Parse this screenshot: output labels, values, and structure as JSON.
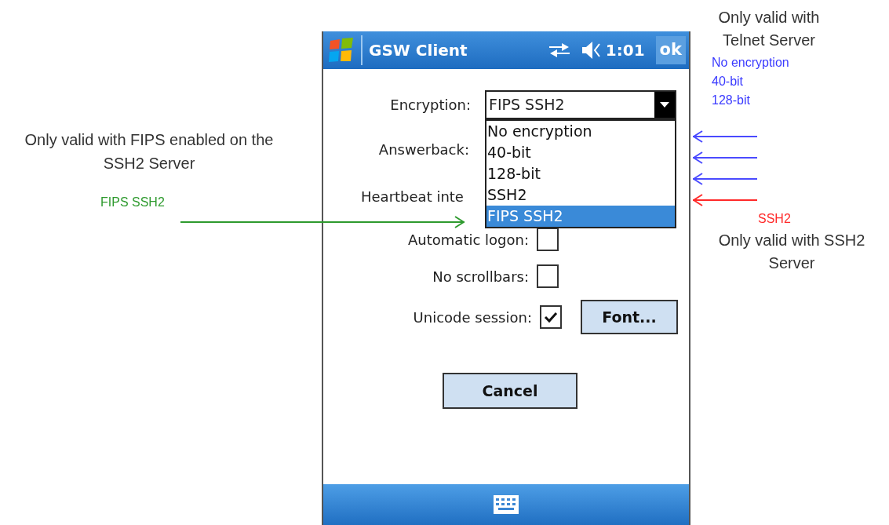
{
  "window": {
    "title": "GSW Client",
    "time": "1:01",
    "ok_label": "ok"
  },
  "form": {
    "encryption": {
      "label": "Encryption:",
      "value": "FIPS SSH2",
      "expanded": true,
      "options": [
        {
          "label": "No encryption",
          "selected": false
        },
        {
          "label": "40-bit",
          "selected": false
        },
        {
          "label": "128-bit",
          "selected": false
        },
        {
          "label": "SSH2",
          "selected": false
        },
        {
          "label": "FIPS SSH2",
          "selected": true
        }
      ]
    },
    "answerback": {
      "label": "Answerback:"
    },
    "heartbeat": {
      "label": "Heartbeat inte"
    },
    "checkboxes": [
      {
        "label": "Automatic logon:",
        "checked": false
      },
      {
        "label": "No scrollbars:",
        "checked": false
      },
      {
        "label": "Unicode session:",
        "checked": true
      }
    ],
    "font_button": "Font...",
    "cancel_button": "Cancel"
  },
  "annotations": {
    "left": {
      "text": "Only valid with FIPS enabled on the SSH2  Server",
      "tag": "FIPS SSH2"
    },
    "top_right": {
      "text": "Only valid with Telnet Server",
      "items": [
        "No encryption",
        "40-bit",
        "128-bit"
      ]
    },
    "bottom_right": {
      "tag": "SSH2",
      "text": "Only valid with SSH2 Server"
    }
  }
}
